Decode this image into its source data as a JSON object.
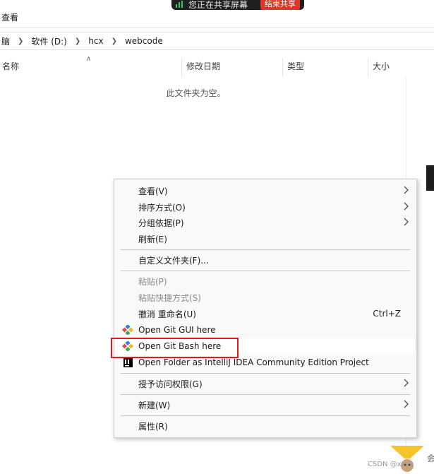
{
  "share_banner": {
    "text": "您正在共享屏幕",
    "stop_label": "结束共享"
  },
  "ribbon": {
    "view_label": "查看"
  },
  "breadcrumb": [
    "脑",
    "软件 (D:)",
    "hcx",
    "webcode"
  ],
  "columns": {
    "name": "名称",
    "date": "修改日期",
    "type": "类型",
    "size": "大小"
  },
  "empty_message": "此文件夹为空。",
  "context_menu": {
    "view": "查看(V)",
    "sort": "排序方式(O)",
    "group": "分组依据(P)",
    "refresh": "刷新(E)",
    "customize": "自定义文件夹(F)...",
    "paste": "粘贴(P)",
    "paste_shortcut": "粘贴快捷方式(S)",
    "undo_rename": "撤消 重命名(U)",
    "undo_shortcut": "Ctrl+Z",
    "git_gui": "Open Git GUI here",
    "git_bash": "Open Git Bash here",
    "intellij": "Open Folder as IntelliJ IDEA Community Edition Project",
    "grant_access": "授予访问权限(G)",
    "new": "新建(W)",
    "properties": "属性(R)"
  },
  "colors": {
    "highlight_border": "#e11b1b",
    "share_green": "#2ecc71",
    "share_stop": "#d9392b"
  },
  "watermark": "CSDN @xxxx",
  "side_char": "会"
}
